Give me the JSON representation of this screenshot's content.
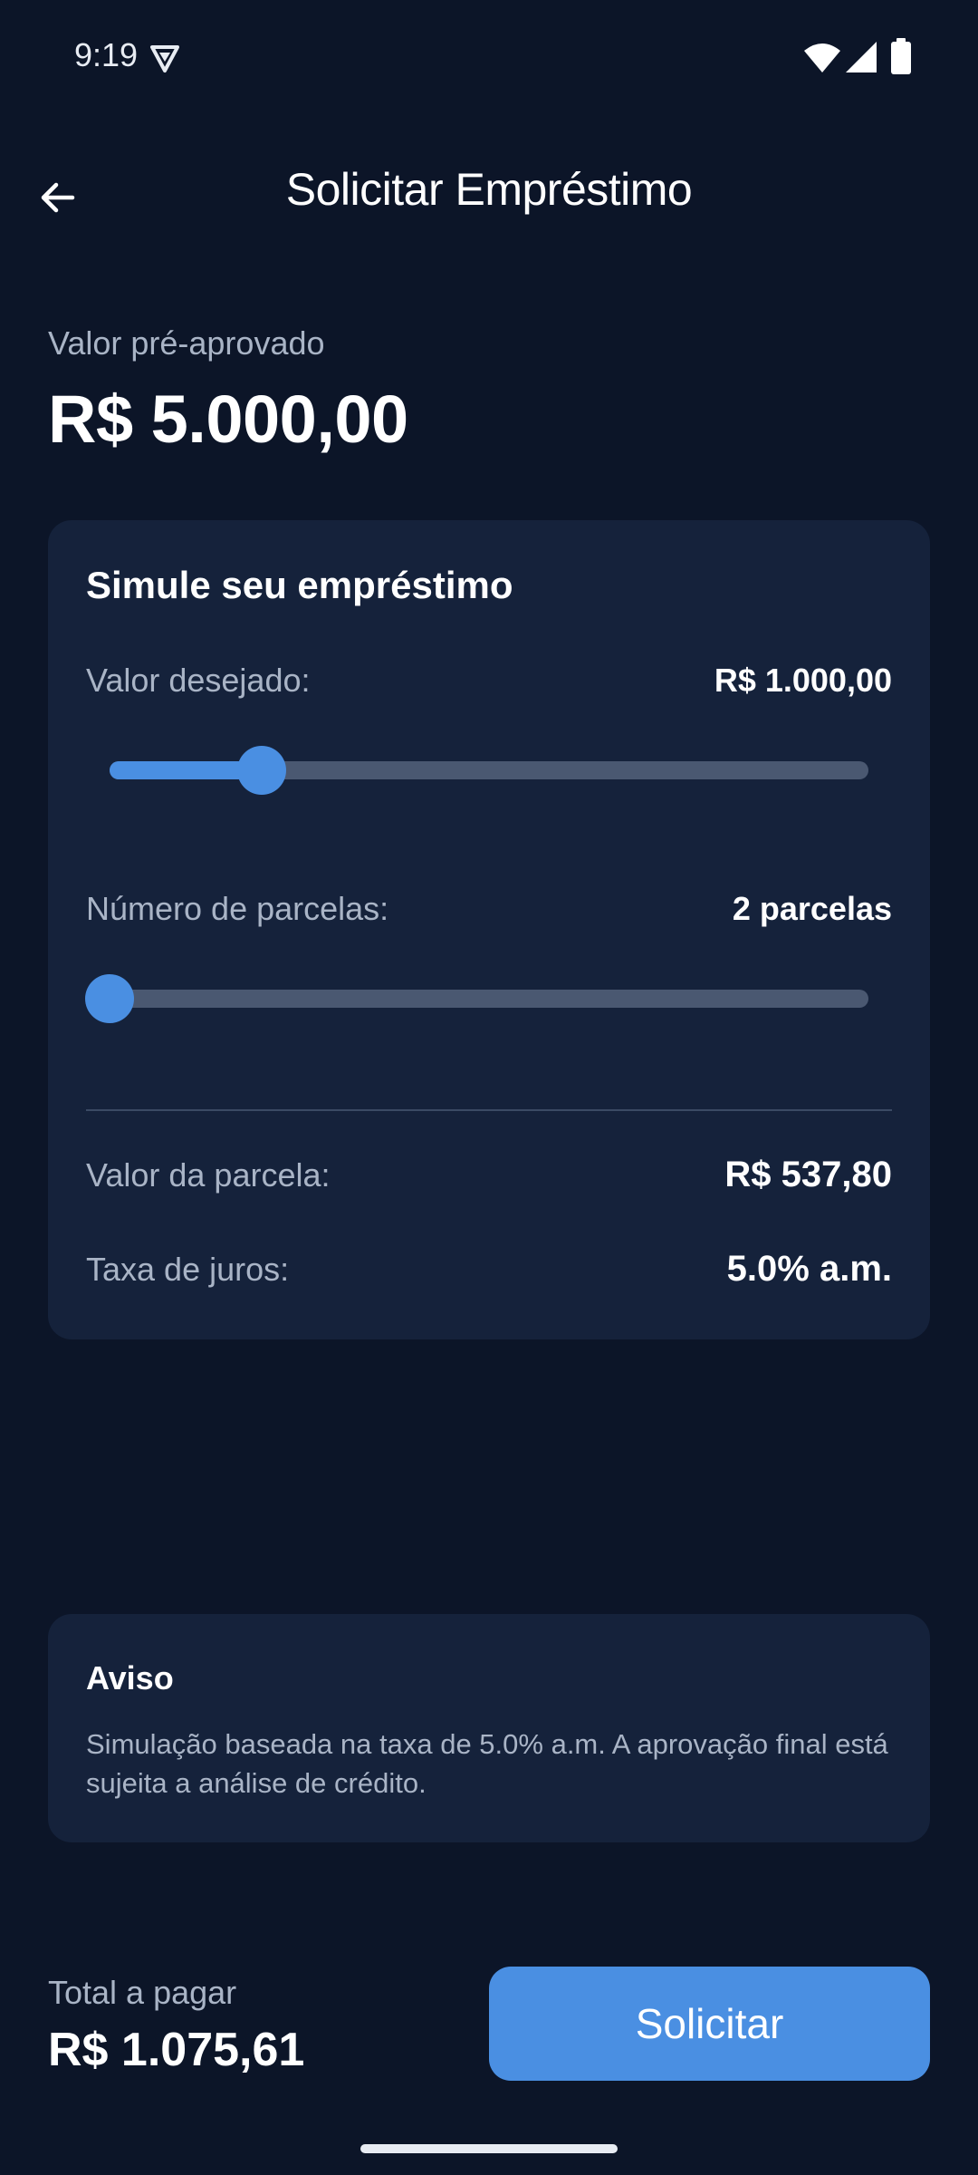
{
  "status_bar": {
    "time": "9:19",
    "icons": [
      "vpn-icon",
      "wifi-icon",
      "signal-icon",
      "battery-icon"
    ]
  },
  "header": {
    "back_icon": "arrow-left-icon",
    "title": "Solicitar Empréstimo"
  },
  "preapproved": {
    "label": "Valor pré-aprovado",
    "value": "R$ 5.000,00"
  },
  "simulation": {
    "title": "Simule seu empréstimo",
    "amount_label": "Valor desejado:",
    "amount_value": "R$ 1.000,00",
    "amount_slider_fraction": 0.2,
    "installments_label": "Número de parcelas:",
    "installments_value": "2 parcelas",
    "installments_slider_fraction": 0.0,
    "installment_value_label": "Valor da parcela:",
    "installment_value": "R$ 537,80",
    "rate_label": "Taxa de juros:",
    "rate_value": "5.0% a.m."
  },
  "notice": {
    "title": "Aviso",
    "text": "Simulação baseada na taxa de 5.0% a.m. A aprovação final está sujeita a análise de crédito."
  },
  "footer": {
    "total_label": "Total a pagar",
    "total_value": "R$ 1.075,61",
    "submit_label": "Solicitar"
  },
  "colors": {
    "background": "#0c1528",
    "card": "#15223b",
    "accent": "#4a8fe2",
    "muted_text": "#a9b4c6",
    "track": "#4a5871"
  }
}
